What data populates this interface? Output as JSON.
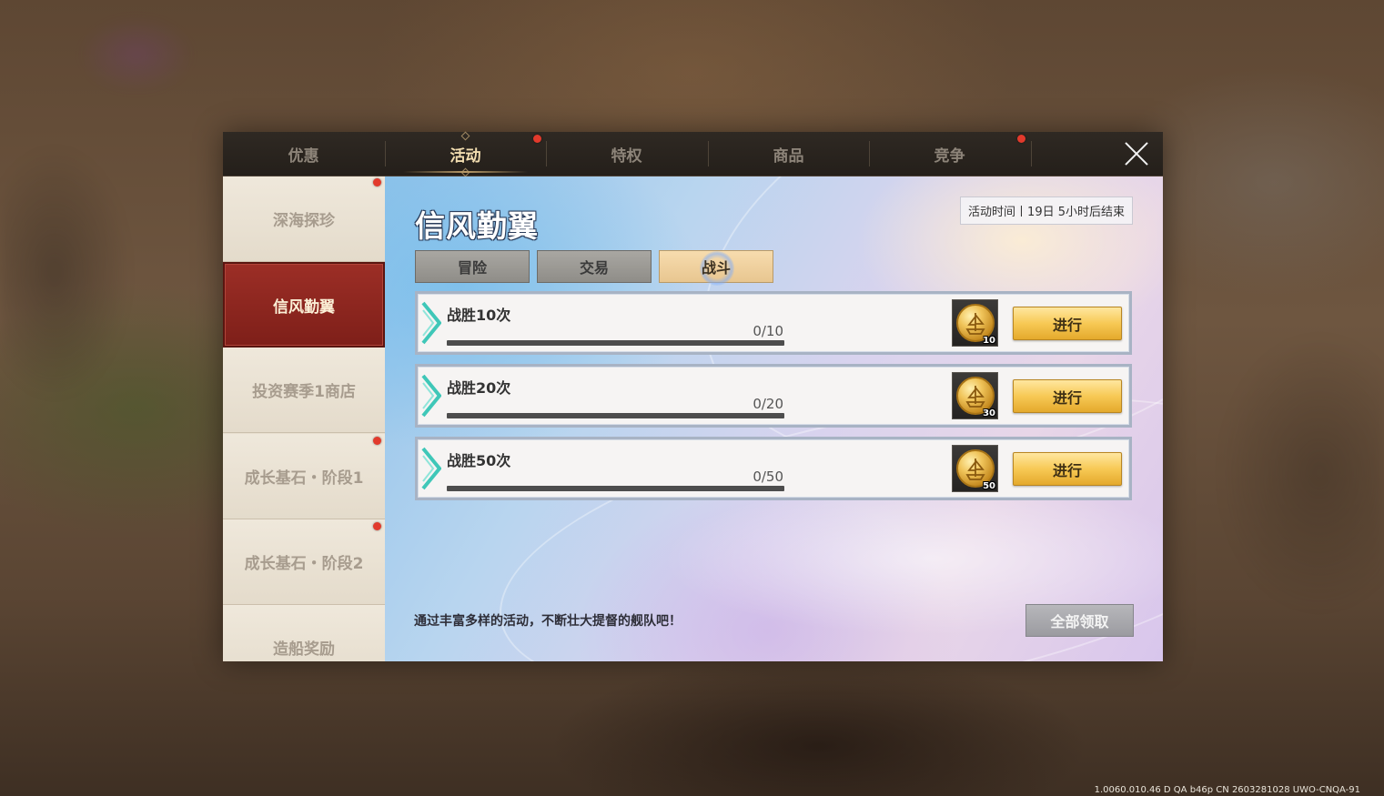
{
  "top_tabs": [
    {
      "label": "优惠",
      "active": false,
      "notify": false
    },
    {
      "label": "活动",
      "active": true,
      "notify": true
    },
    {
      "label": "特权",
      "active": false,
      "notify": false
    },
    {
      "label": "商品",
      "active": false,
      "notify": false
    },
    {
      "label": "竞争",
      "active": false,
      "notify": true
    }
  ],
  "sidebar": {
    "items": [
      {
        "label": "深海探珍",
        "active": false,
        "notify": true
      },
      {
        "label": "信风勤翼",
        "active": true,
        "notify": false
      },
      {
        "label": "投资赛季1商店",
        "active": false,
        "notify": false
      },
      {
        "label": "成长基石・阶段1",
        "active": false,
        "notify": true
      },
      {
        "label": "成长基石・阶段2",
        "active": false,
        "notify": true
      },
      {
        "label": "造船奖励",
        "active": false,
        "notify": false
      }
    ]
  },
  "event": {
    "title": "信风勤翼",
    "time_text": "活动时间丨19日 5小时后结束",
    "sub_tabs": [
      {
        "label": "冒险",
        "active": false
      },
      {
        "label": "交易",
        "active": false
      },
      {
        "label": "战斗",
        "active": true
      }
    ],
    "tasks": [
      {
        "name": "战胜10次",
        "progress_text": "0/10",
        "progress": 0,
        "reward_qty": "10",
        "button": "进行"
      },
      {
        "name": "战胜20次",
        "progress_text": "0/20",
        "progress": 0,
        "reward_qty": "30",
        "button": "进行"
      },
      {
        "name": "战胜50次",
        "progress_text": "0/50",
        "progress": 0,
        "reward_qty": "50",
        "button": "进行"
      }
    ],
    "footer_text": "通过丰富多样的活动，不断壮大提督的舰队吧！",
    "claim_all_label": "全部领取",
    "reward_icon": "gold-ship-coin-icon"
  },
  "version": "1.0060.010.46 D QA b46p CN 2603281028 UWO-CNQA-91",
  "colors": {
    "accent_gold": "#f7c955",
    "active_sidebar": "#9c2e26",
    "notify_dot": "#e23a2c"
  }
}
